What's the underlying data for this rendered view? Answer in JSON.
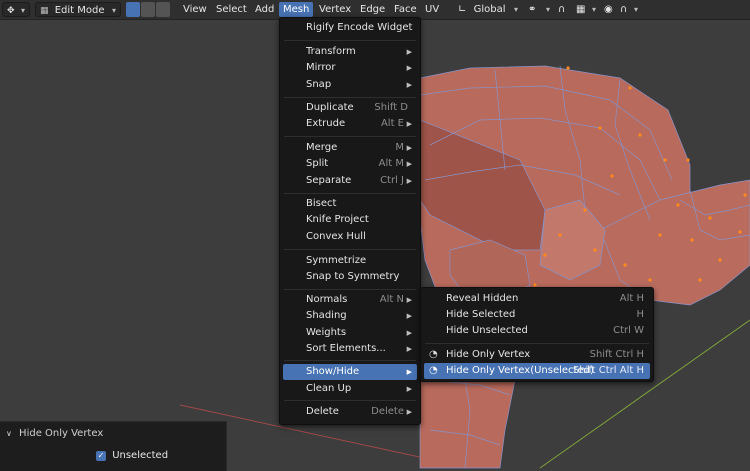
{
  "header": {
    "mode": "Edit Mode",
    "menus": [
      "View",
      "Select",
      "Add",
      "Mesh",
      "Vertex",
      "Edge",
      "Face",
      "UV"
    ],
    "transform_orientation": "Global"
  },
  "mesh_menu": {
    "items": [
      {
        "label": "Rigify Encode Widget",
        "shortcut": "",
        "submenu": false
      },
      {
        "label": "Transform",
        "shortcut": "",
        "submenu": true
      },
      {
        "label": "Mirror",
        "shortcut": "",
        "submenu": true
      },
      {
        "label": "Snap",
        "shortcut": "",
        "submenu": true
      },
      {
        "label": "Duplicate",
        "shortcut": "Shift D",
        "submenu": false
      },
      {
        "label": "Extrude",
        "shortcut": "Alt E",
        "submenu": true
      },
      {
        "label": "Merge",
        "shortcut": "M",
        "submenu": true
      },
      {
        "label": "Split",
        "shortcut": "Alt M",
        "submenu": true
      },
      {
        "label": "Separate",
        "shortcut": "Ctrl J",
        "submenu": true
      },
      {
        "label": "Bisect",
        "shortcut": "",
        "submenu": false
      },
      {
        "label": "Knife Project",
        "shortcut": "",
        "submenu": false
      },
      {
        "label": "Convex Hull",
        "shortcut": "",
        "submenu": false
      },
      {
        "label": "Symmetrize",
        "shortcut": "",
        "submenu": false
      },
      {
        "label": "Snap to Symmetry",
        "shortcut": "",
        "submenu": false
      },
      {
        "label": "Normals",
        "shortcut": "Alt N",
        "submenu": true
      },
      {
        "label": "Shading",
        "shortcut": "",
        "submenu": true
      },
      {
        "label": "Weights",
        "shortcut": "",
        "submenu": true
      },
      {
        "label": "Sort Elements...",
        "shortcut": "",
        "submenu": true
      },
      {
        "label": "Show/Hide",
        "shortcut": "",
        "submenu": true,
        "highlighted": true
      },
      {
        "label": "Clean Up",
        "shortcut": "",
        "submenu": true
      },
      {
        "label": "Delete",
        "shortcut": "Delete",
        "submenu": true
      }
    ]
  },
  "showhide_menu": {
    "items": [
      {
        "label": "Reveal Hidden",
        "shortcut": "Alt H",
        "icon": ""
      },
      {
        "label": "Hide Selected",
        "shortcut": "H",
        "icon": ""
      },
      {
        "label": "Hide Unselected",
        "shortcut": "Ctrl W",
        "icon": ""
      },
      {
        "label": "Hide Only Vertex",
        "shortcut": "Shift Ctrl H",
        "icon": "eye-icon"
      },
      {
        "label": "Hide Only Vertex(Unselected)",
        "shortcut": "Shift Ctrl Alt H",
        "icon": "eye-icon",
        "highlighted": true
      }
    ]
  },
  "operator_panel": {
    "title": "Hide Only Vertex",
    "checkbox_label": "Unselected",
    "checkbox_checked": true
  },
  "colors": {
    "header_bg": "#2f2f2f",
    "menu_bg": "#181818",
    "highlight": "#4772b3",
    "mesh_face": "#b96a5c",
    "selected_vertex": "#ff8a1c",
    "viewport_bg": "#3d3d3d"
  }
}
